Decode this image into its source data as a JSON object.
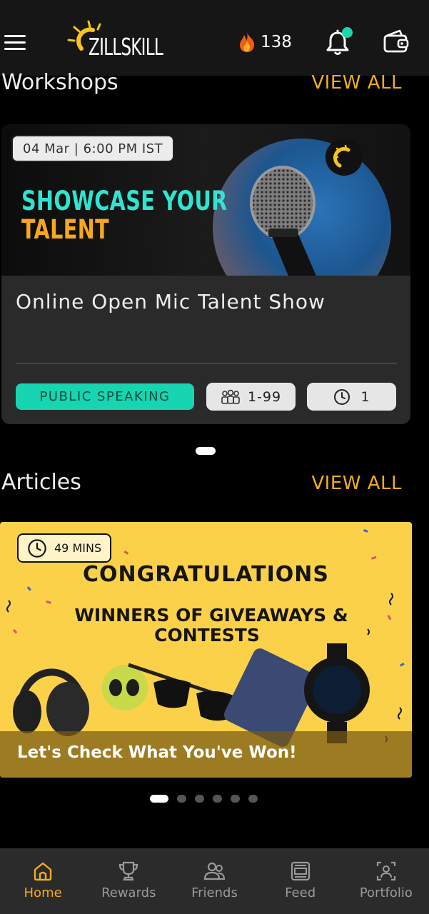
{
  "header": {
    "brand": "ZILLSKILL",
    "streak_count": "138"
  },
  "workshops": {
    "section_title": "Workshops",
    "view_all": "VIEW ALL",
    "card": {
      "date": "04 Mar | 6:00 PM IST",
      "banner_line1": "SHOWCASE YOUR",
      "banner_line2": "TALENT",
      "title": "Online Open Mic Talent Show",
      "category": "PUBLIC SPEAKING",
      "participants": "1-99",
      "duration": "1"
    }
  },
  "articles": {
    "section_title": "Articles",
    "view_all": "VIEW ALL",
    "card": {
      "read_time": "49 MINS",
      "headline1": "CONGRATULATIONS",
      "headline2": "WINNERS OF GIVEAWAYS &",
      "headline3": "CONTESTS",
      "caption": "Let's Check What You've Won!"
    }
  },
  "bottom_nav": {
    "items": [
      {
        "label": "Home",
        "icon": "home-icon",
        "active": true
      },
      {
        "label": "Rewards",
        "icon": "trophy-icon",
        "active": false
      },
      {
        "label": "Friends",
        "icon": "friends-icon",
        "active": false
      },
      {
        "label": "Feed",
        "icon": "feed-icon",
        "active": false
      },
      {
        "label": "Portfolio",
        "icon": "portfolio-icon",
        "active": false
      }
    ]
  },
  "colors": {
    "accent": "#f2ac1c",
    "teal": "#17d5b0",
    "background": "#000000"
  }
}
